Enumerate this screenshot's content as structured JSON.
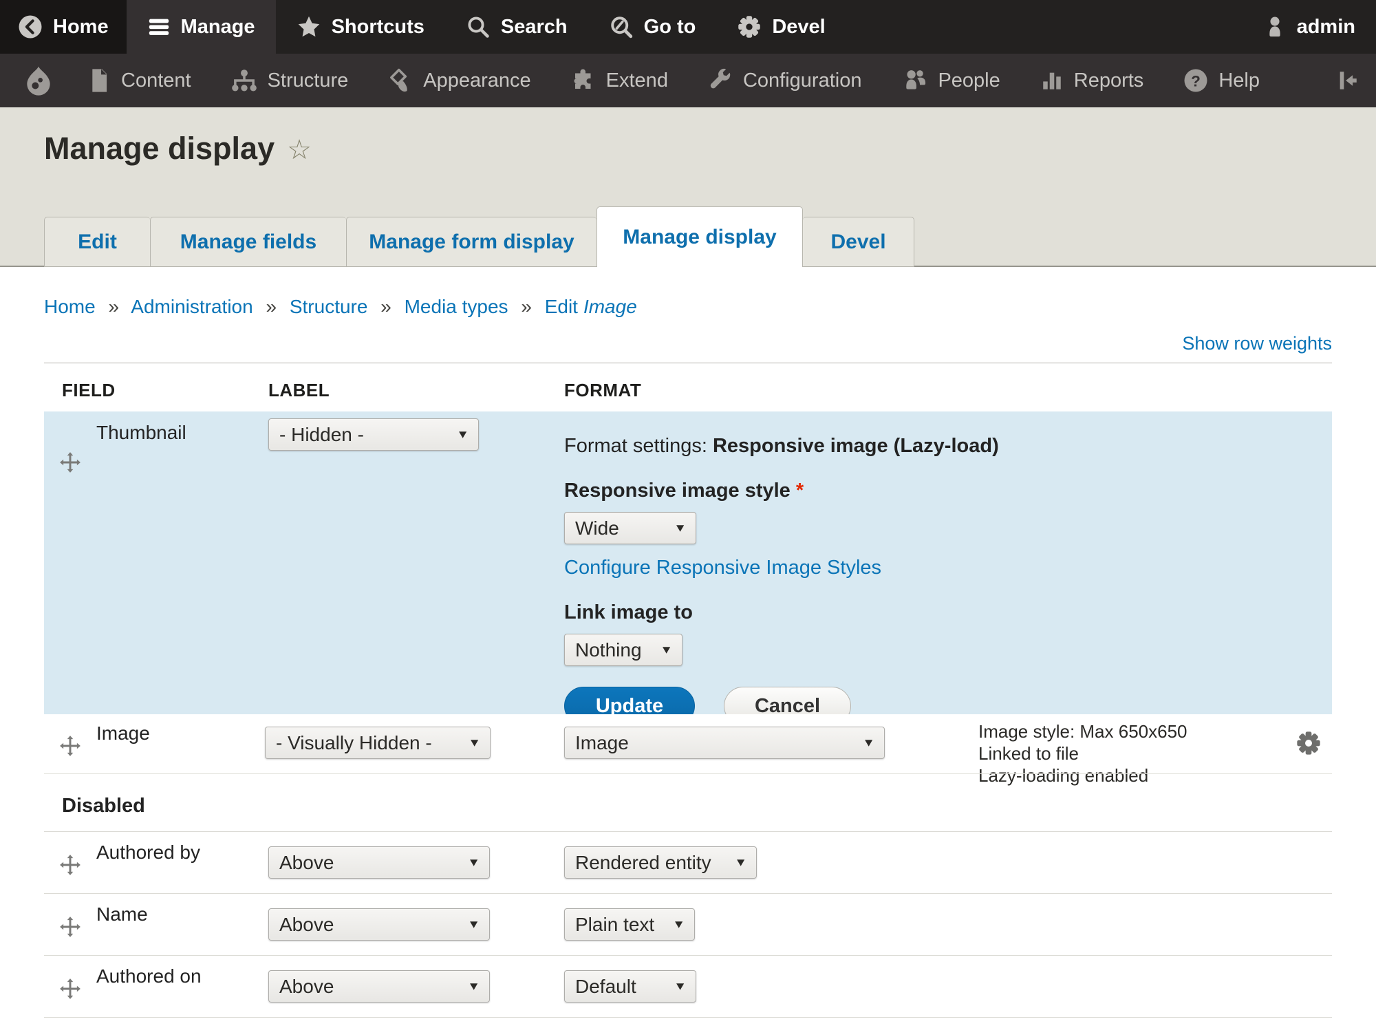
{
  "icons": {
    "favorite_star": "☆",
    "dropdown_arrow": "▼",
    "breadcrumb_separator": "»"
  },
  "colors": {
    "accent_link": "#0a74b7",
    "row_highlight": "#d8e9f2",
    "required": "#e32700",
    "primary_button": "#0d76bc",
    "toolbar_bg": "#232120",
    "tray_bg": "#343031"
  },
  "topbar": {
    "items": [
      {
        "label": "Home",
        "icon": "back-to-site-icon"
      },
      {
        "label": "Manage",
        "icon": "hamburger-icon",
        "active": true
      },
      {
        "label": "Shortcuts",
        "icon": "star-icon"
      },
      {
        "label": "Search",
        "icon": "search-icon"
      },
      {
        "label": "Go to",
        "icon": "goto-search-icon"
      },
      {
        "label": "Devel",
        "icon": "gear-icon"
      }
    ],
    "user": {
      "label": "admin",
      "icon": "user-icon"
    }
  },
  "tray": {
    "items": [
      {
        "label": "Content",
        "icon": "file-icon"
      },
      {
        "label": "Structure",
        "icon": "sitemap-icon"
      },
      {
        "label": "Appearance",
        "icon": "brush-icon"
      },
      {
        "label": "Extend",
        "icon": "puzzle-icon"
      },
      {
        "label": "Configuration",
        "icon": "wrench-icon"
      },
      {
        "label": "People",
        "icon": "people-icon"
      },
      {
        "label": "Reports",
        "icon": "bar-chart-icon"
      },
      {
        "label": "Help",
        "icon": "help-icon"
      }
    ],
    "logo_icon": "drupal-logo",
    "collapse_icon": "collapse-left-icon"
  },
  "page": {
    "title": "Manage display"
  },
  "tabs": [
    {
      "label": "Edit"
    },
    {
      "label": "Manage fields"
    },
    {
      "label": "Manage form display"
    },
    {
      "label": "Manage display",
      "active": true
    },
    {
      "label": "Devel"
    }
  ],
  "breadcrumb": {
    "items": [
      "Home",
      "Administration",
      "Structure",
      "Media types"
    ],
    "last_prefix": "Edit",
    "last_italic": "Image"
  },
  "table": {
    "show_row_weights": "Show row weights",
    "headers": {
      "field": "FIELD",
      "label": "LABEL",
      "format": "FORMAT"
    },
    "thumbnail": {
      "name": "Thumbnail",
      "label_select": "- Hidden -",
      "settings_prefix": "Format settings:",
      "settings_name": "Responsive image (Lazy-load)",
      "style_label": "Responsive image style",
      "required_mark": "*",
      "style_select": "Wide",
      "configure_link": "Configure Responsive Image Styles",
      "link_label": "Link image to",
      "link_select": "Nothing",
      "update_btn": "Update",
      "cancel_btn": "Cancel"
    },
    "image": {
      "name": "Image",
      "label_select": "- Visually Hidden -",
      "format_select": "Image",
      "summary": [
        "Image style: Max 650x650",
        "Linked to file",
        "Lazy-loading enabled"
      ]
    },
    "disabled_heading": "Disabled",
    "disabled_rows": [
      {
        "name": "Authored by",
        "label_select": "Above",
        "format_select": "Rendered entity"
      },
      {
        "name": "Name",
        "label_select": "Above",
        "format_select": "Plain text"
      },
      {
        "name": "Authored on",
        "label_select": "Above",
        "format_select": "Default"
      }
    ]
  }
}
